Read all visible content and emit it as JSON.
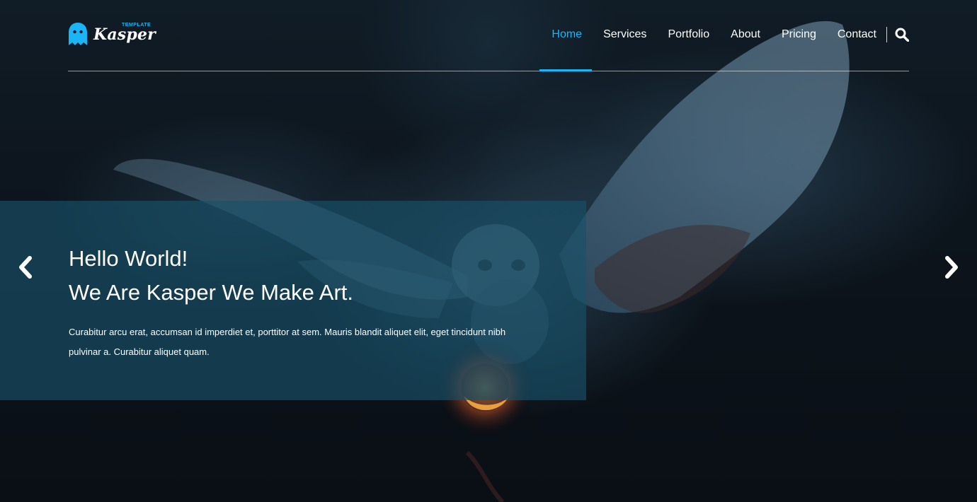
{
  "brand": {
    "name": "Kasper",
    "tagline": "TEMPLATE",
    "accent_color": "#19b5f7",
    "logo_icon": "ghost-icon"
  },
  "nav": {
    "items": [
      {
        "label": "Home",
        "active": true
      },
      {
        "label": "Services",
        "active": false
      },
      {
        "label": "Portfolio",
        "active": false
      },
      {
        "label": "About",
        "active": false
      },
      {
        "label": "Pricing",
        "active": false
      },
      {
        "label": "Contact",
        "active": false
      }
    ],
    "search_icon": "search-icon"
  },
  "hero": {
    "heading_line1": "Hello World!",
    "heading_line2": "We Are Kasper We Make Art.",
    "body": "Curabitur arcu erat, accumsan id imperdiet et, porttitor at sem. Mauris blandit aliquet elit, eget tincidunt nibh pulvinar a. Curabitur aliquet quam.",
    "prev_icon": "chevron-left-icon",
    "next_icon": "chevron-right-icon"
  }
}
